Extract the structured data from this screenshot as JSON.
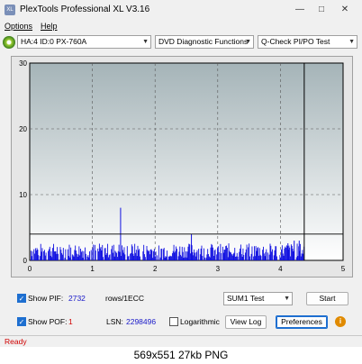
{
  "window": {
    "title": "PlexTools Professional XL V3.16",
    "icon": "app-icon",
    "minimize": "—",
    "maximize": "□",
    "close": "✕"
  },
  "menu": {
    "items": [
      "Options",
      "Help"
    ]
  },
  "toolbar": {
    "drive": "HA:4 ID:0  PX-760A",
    "function": "DVD Diagnostic Functions",
    "test": "Q-Check PI/PO Test"
  },
  "chart_data": {
    "type": "bar",
    "title": "",
    "xlabel": "",
    "ylabel": "",
    "xlim": [
      0,
      5
    ],
    "ylim": [
      0,
      30
    ],
    "x_ticks": [
      "0",
      "1",
      "2",
      "3",
      "4",
      "5"
    ],
    "y_ticks": [
      "0",
      "10",
      "20",
      "30"
    ],
    "threshold_line": 4,
    "end_marker_x": 4.38,
    "grid": true,
    "colors": {
      "plot_top": "#a5b4b8",
      "plot_bottom": "#ffffff",
      "bars": "#1010e0"
    },
    "spikes": [
      {
        "x": 1.45,
        "y": 8
      },
      {
        "x": 2.58,
        "y": 4
      },
      {
        "x": 4.22,
        "y": 3
      },
      {
        "x": 4.12,
        "y": 2.6
      },
      {
        "x": 4.3,
        "y": 3
      }
    ]
  },
  "options": {
    "show_pif_label": "Show PIF:",
    "pif_value": "2732",
    "pif_unit": "rows/1ECC",
    "show_pof_label": "Show POF:",
    "pof_value": "1",
    "lsn_label": "LSN:",
    "lsn_value": "2298496",
    "logarithmic_label": "Logarithmic",
    "sum_select": "SUM1 Test",
    "start_label": "Start",
    "view_log_label": "View Log",
    "preferences_label": "Preferences",
    "info_icon": "info-icon"
  },
  "status": {
    "text": "Ready"
  },
  "caption": {
    "text": "569x551  27kb  PNG"
  }
}
